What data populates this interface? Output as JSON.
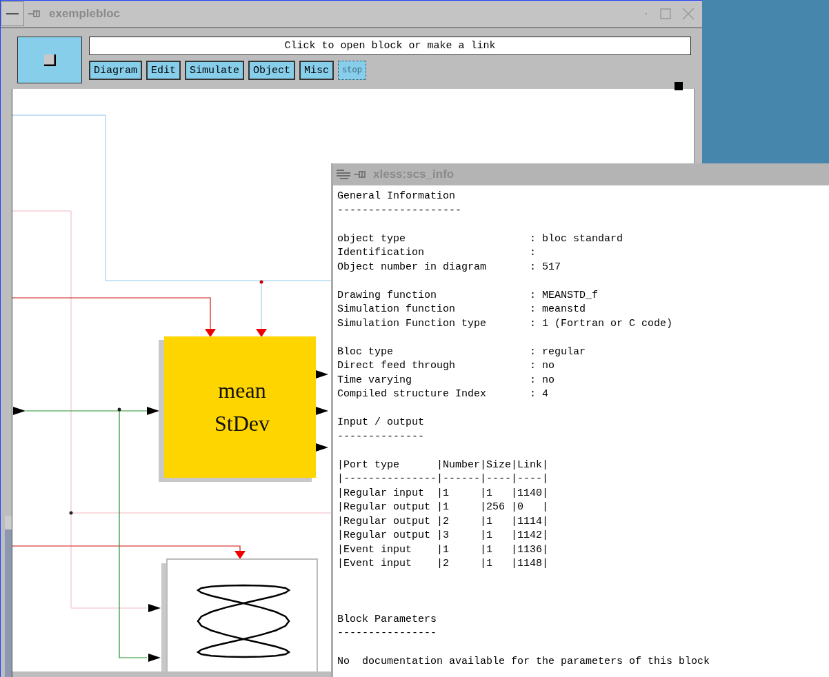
{
  "main_window": {
    "title": "exemplebloc",
    "message": "Click to open block or make a link",
    "menu_buttons": [
      {
        "label": "Diagram",
        "disabled": false
      },
      {
        "label": "Edit",
        "disabled": false
      },
      {
        "label": "Simulate",
        "disabled": false
      },
      {
        "label": "Object",
        "disabled": false
      },
      {
        "label": "Misc",
        "disabled": false
      },
      {
        "label": "stop",
        "disabled": true
      }
    ]
  },
  "diagram": {
    "blocks": [
      {
        "kind": "text",
        "lines": [
          "mean",
          "StDev"
        ]
      },
      {
        "kind": "scope"
      }
    ]
  },
  "info_window": {
    "title": "xless:scs_info",
    "blocks": [
      {
        "kind": "heading",
        "text": "General Information",
        "rule": "--------------------"
      },
      {
        "kind": "fields",
        "rows": [
          {
            "label": "object type",
            "value": ": bloc standard"
          },
          {
            "label": "Identification",
            "value": ":"
          },
          {
            "label": "Object number in diagram",
            "value": ": 517"
          }
        ]
      },
      {
        "kind": "fields",
        "rows": [
          {
            "label": "Drawing function",
            "value": ": MEANSTD_f"
          },
          {
            "label": "Simulation function",
            "value": ": meanstd"
          },
          {
            "label": "Simulation Function type",
            "value": ": 1 (Fortran or C code)"
          }
        ]
      },
      {
        "kind": "fields",
        "rows": [
          {
            "label": "Bloc type",
            "value": ": regular"
          },
          {
            "label": "Direct feed through",
            "value": ": no"
          },
          {
            "label": "Time varying",
            "value": ": no"
          },
          {
            "label": "Compiled structure Index",
            "value": ": 4"
          }
        ]
      },
      {
        "kind": "heading",
        "text": "Input / output",
        "rule": "--------------"
      },
      {
        "kind": "table",
        "lines": [
          "|Port type      |Number|Size|Link|",
          "|---------------|------|----|----|",
          "|Regular input  |1     |1   |1140|",
          "|Regular output |1     |256 |0   |",
          "|Regular output |2     |1   |1114|",
          "|Regular output |3     |1   |1142|",
          "|Event input    |1     |1   |1136|",
          "|Event input    |2     |1   |1148|"
        ]
      },
      {
        "kind": "heading",
        "text": "Block Parameters",
        "rule": "----------------"
      },
      {
        "kind": "text",
        "text": "No  documentation available for the parameters of this block"
      }
    ]
  }
}
